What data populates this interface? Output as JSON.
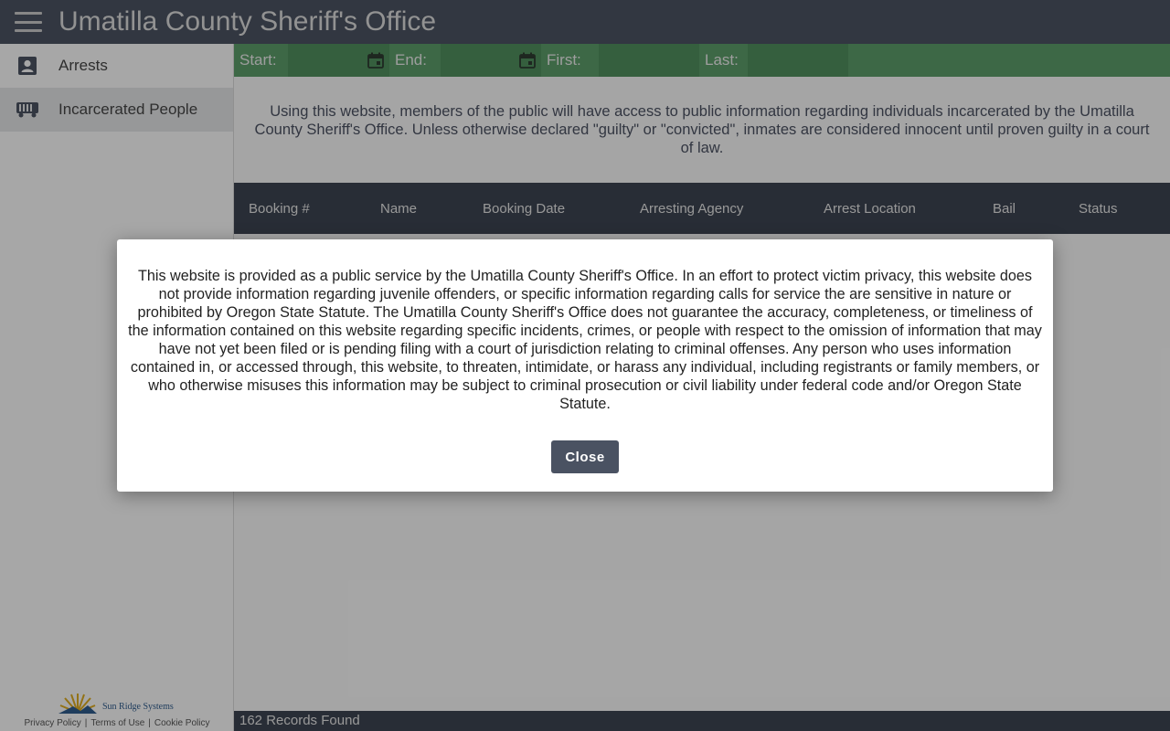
{
  "header": {
    "title": "Umatilla County Sheriff's Office",
    "menu_icon": "hamburger-menu-icon"
  },
  "sidebar": {
    "items": [
      {
        "label": "Arrests",
        "icon": "person-badge-icon",
        "active": false
      },
      {
        "label": "Incarcerated People",
        "icon": "jail-bus-icon",
        "active": true
      }
    ],
    "footer": {
      "logo_text": "Sun Ridge Systems",
      "links": [
        "Privacy Policy",
        "Terms of Use",
        "Cookie Policy"
      ],
      "separator": "|"
    }
  },
  "filters": {
    "start_label": "Start:",
    "start_value": "",
    "end_label": "End:",
    "end_value": "",
    "first_label": "First:",
    "first_value": "",
    "last_label": "Last:",
    "last_value": ""
  },
  "intro_text": "Using this website, members of the public will have access to public information regarding individuals incarcerated by the Umatilla County Sheriff's Office. Unless otherwise declared \"guilty\" or \"convicted\", inmates are considered innocent until proven guilty in a court of law.",
  "table": {
    "columns": [
      "Booking #",
      "Name",
      "Booking Date",
      "Arresting Agency",
      "Arrest Location",
      "Bail",
      "Status"
    ]
  },
  "records_found": "162 Records Found",
  "modal": {
    "text": "This website is provided as a public service by the Umatilla County Sheriff's Office. In an effort to protect victim privacy, this website does not provide information regarding juvenile offenders, or specific information regarding calls for service the are sensitive in nature or prohibited by Oregon State Statute. The Umatilla County Sheriff's Office does not guarantee the accuracy, completeness, or timeliness of the information contained on this website regarding specific incidents, crimes, or people with respect to the omission of information that may have not yet been filed or is pending filing with a court of jurisdiction relating to criminal offenses. Any person who uses information contained in, or accessed through, this website, to threaten, intimidate, or harass any individual, including registrants or family members, or who otherwise misuses this information may be subject to criminal prosecution or civil liability under federal code and/or Oregon State Statute.",
    "close_label": "Close"
  },
  "colors": {
    "header_bg": "#4a5260",
    "filter_bg": "#5a9a67",
    "table_header_bg": "#3c4350",
    "button_bg": "#4a5262"
  }
}
